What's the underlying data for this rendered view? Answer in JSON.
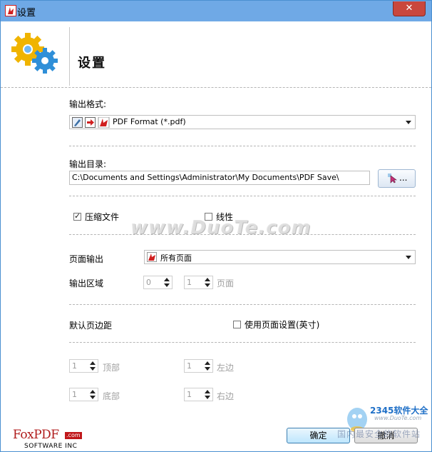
{
  "window": {
    "title": "设置",
    "close_symbol": "✕"
  },
  "header": {
    "title": "设置"
  },
  "output_format": {
    "label": "输出格式:",
    "selected": "PDF Format (*.pdf)"
  },
  "output_dir": {
    "label": "输出目录:",
    "value": "C:\\Documents and Settings\\Administrator\\My Documents\\PDF Save\\",
    "browse_label": "..."
  },
  "options": {
    "compress_label": "压缩文件",
    "compress_checked": true,
    "linear_label": "线性",
    "linear_checked": false
  },
  "page_output": {
    "label": "页面输出",
    "selected": "所有页面",
    "range_label": "输出区域",
    "range_from": "0",
    "range_to": "1",
    "range_unit": "页面"
  },
  "margins": {
    "label": "默认页边距",
    "use_page_settings_label": "使用页面设置(英寸)",
    "use_page_settings_checked": false,
    "top_value": "1",
    "top_label": "顶部",
    "left_value": "1",
    "left_label": "左边",
    "bottom_value": "1",
    "bottom_label": "底部",
    "right_value": "1",
    "right_label": "右边"
  },
  "buttons": {
    "ok": "确定",
    "cancel": "撤消"
  },
  "logo": {
    "brand": "FoxPDF",
    "domain": ".com",
    "sub": "SOFTWARE INC"
  },
  "watermarks": {
    "duote": "www.DuoTe.com",
    "site_name": "2345软件大全",
    "site_url": "www.DuoTe.com",
    "site_tagline": "国内最安全的软件站"
  },
  "colors": {
    "titlebar": "#6fa9e6",
    "close": "#c9473d",
    "pdf_red": "#c0181b"
  }
}
